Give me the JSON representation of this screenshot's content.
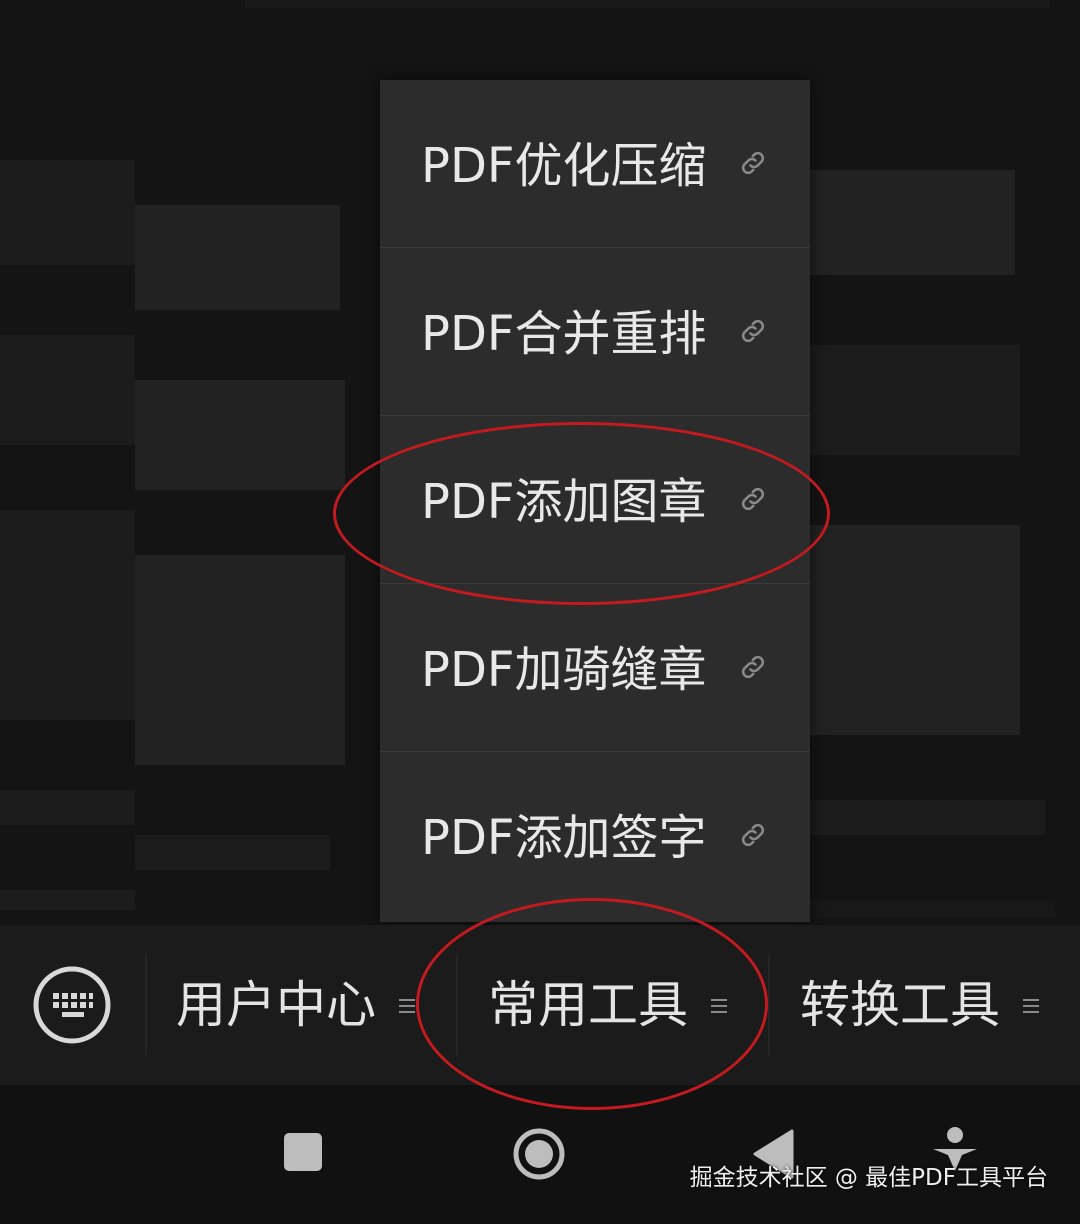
{
  "popup_menu": {
    "items": [
      {
        "label": "PDF优化压缩",
        "icon": "link-icon"
      },
      {
        "label": "PDF合并重排",
        "icon": "link-icon"
      },
      {
        "label": "PDF添加图章",
        "icon": "link-icon"
      },
      {
        "label": "PDF加骑缝章",
        "icon": "link-icon"
      },
      {
        "label": "PDF添加签字",
        "icon": "link-icon"
      }
    ]
  },
  "tab_bar": {
    "keyboard_icon": "keyboard-icon",
    "tabs": [
      {
        "label": "用户中心",
        "icon": "menu-icon"
      },
      {
        "label": "常用工具",
        "icon": "menu-icon"
      },
      {
        "label": "转换工具",
        "icon": "menu-icon"
      }
    ]
  },
  "nav_bar": {
    "icons": [
      "recent-apps-icon",
      "home-icon",
      "back-icon",
      "accessibility-icon"
    ]
  },
  "watermark": "掘金技术社区 @ 最佳PDF工具平台",
  "colors": {
    "background": "#111111",
    "popup": "#2c2c2c",
    "annotation": "#c41a1f",
    "text": "#e8e8e8"
  }
}
